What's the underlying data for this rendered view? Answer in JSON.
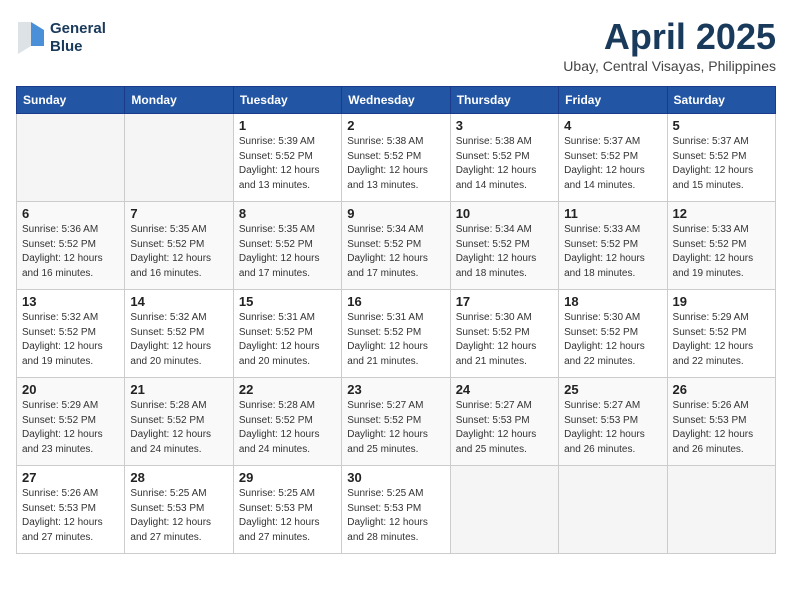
{
  "header": {
    "logo_line1": "General",
    "logo_line2": "Blue",
    "month_title": "April 2025",
    "location": "Ubay, Central Visayas, Philippines"
  },
  "weekdays": [
    "Sunday",
    "Monday",
    "Tuesday",
    "Wednesday",
    "Thursday",
    "Friday",
    "Saturday"
  ],
  "weeks": [
    [
      {
        "day": null,
        "sunrise": null,
        "sunset": null,
        "daylight": null
      },
      {
        "day": null,
        "sunrise": null,
        "sunset": null,
        "daylight": null
      },
      {
        "day": "1",
        "sunrise": "Sunrise: 5:39 AM",
        "sunset": "Sunset: 5:52 PM",
        "daylight": "Daylight: 12 hours and 13 minutes."
      },
      {
        "day": "2",
        "sunrise": "Sunrise: 5:38 AM",
        "sunset": "Sunset: 5:52 PM",
        "daylight": "Daylight: 12 hours and 13 minutes."
      },
      {
        "day": "3",
        "sunrise": "Sunrise: 5:38 AM",
        "sunset": "Sunset: 5:52 PM",
        "daylight": "Daylight: 12 hours and 14 minutes."
      },
      {
        "day": "4",
        "sunrise": "Sunrise: 5:37 AM",
        "sunset": "Sunset: 5:52 PM",
        "daylight": "Daylight: 12 hours and 14 minutes."
      },
      {
        "day": "5",
        "sunrise": "Sunrise: 5:37 AM",
        "sunset": "Sunset: 5:52 PM",
        "daylight": "Daylight: 12 hours and 15 minutes."
      }
    ],
    [
      {
        "day": "6",
        "sunrise": "Sunrise: 5:36 AM",
        "sunset": "Sunset: 5:52 PM",
        "daylight": "Daylight: 12 hours and 16 minutes."
      },
      {
        "day": "7",
        "sunrise": "Sunrise: 5:35 AM",
        "sunset": "Sunset: 5:52 PM",
        "daylight": "Daylight: 12 hours and 16 minutes."
      },
      {
        "day": "8",
        "sunrise": "Sunrise: 5:35 AM",
        "sunset": "Sunset: 5:52 PM",
        "daylight": "Daylight: 12 hours and 17 minutes."
      },
      {
        "day": "9",
        "sunrise": "Sunrise: 5:34 AM",
        "sunset": "Sunset: 5:52 PM",
        "daylight": "Daylight: 12 hours and 17 minutes."
      },
      {
        "day": "10",
        "sunrise": "Sunrise: 5:34 AM",
        "sunset": "Sunset: 5:52 PM",
        "daylight": "Daylight: 12 hours and 18 minutes."
      },
      {
        "day": "11",
        "sunrise": "Sunrise: 5:33 AM",
        "sunset": "Sunset: 5:52 PM",
        "daylight": "Daylight: 12 hours and 18 minutes."
      },
      {
        "day": "12",
        "sunrise": "Sunrise: 5:33 AM",
        "sunset": "Sunset: 5:52 PM",
        "daylight": "Daylight: 12 hours and 19 minutes."
      }
    ],
    [
      {
        "day": "13",
        "sunrise": "Sunrise: 5:32 AM",
        "sunset": "Sunset: 5:52 PM",
        "daylight": "Daylight: 12 hours and 19 minutes."
      },
      {
        "day": "14",
        "sunrise": "Sunrise: 5:32 AM",
        "sunset": "Sunset: 5:52 PM",
        "daylight": "Daylight: 12 hours and 20 minutes."
      },
      {
        "day": "15",
        "sunrise": "Sunrise: 5:31 AM",
        "sunset": "Sunset: 5:52 PM",
        "daylight": "Daylight: 12 hours and 20 minutes."
      },
      {
        "day": "16",
        "sunrise": "Sunrise: 5:31 AM",
        "sunset": "Sunset: 5:52 PM",
        "daylight": "Daylight: 12 hours and 21 minutes."
      },
      {
        "day": "17",
        "sunrise": "Sunrise: 5:30 AM",
        "sunset": "Sunset: 5:52 PM",
        "daylight": "Daylight: 12 hours and 21 minutes."
      },
      {
        "day": "18",
        "sunrise": "Sunrise: 5:30 AM",
        "sunset": "Sunset: 5:52 PM",
        "daylight": "Daylight: 12 hours and 22 minutes."
      },
      {
        "day": "19",
        "sunrise": "Sunrise: 5:29 AM",
        "sunset": "Sunset: 5:52 PM",
        "daylight": "Daylight: 12 hours and 22 minutes."
      }
    ],
    [
      {
        "day": "20",
        "sunrise": "Sunrise: 5:29 AM",
        "sunset": "Sunset: 5:52 PM",
        "daylight": "Daylight: 12 hours and 23 minutes."
      },
      {
        "day": "21",
        "sunrise": "Sunrise: 5:28 AM",
        "sunset": "Sunset: 5:52 PM",
        "daylight": "Daylight: 12 hours and 24 minutes."
      },
      {
        "day": "22",
        "sunrise": "Sunrise: 5:28 AM",
        "sunset": "Sunset: 5:52 PM",
        "daylight": "Daylight: 12 hours and 24 minutes."
      },
      {
        "day": "23",
        "sunrise": "Sunrise: 5:27 AM",
        "sunset": "Sunset: 5:52 PM",
        "daylight": "Daylight: 12 hours and 25 minutes."
      },
      {
        "day": "24",
        "sunrise": "Sunrise: 5:27 AM",
        "sunset": "Sunset: 5:53 PM",
        "daylight": "Daylight: 12 hours and 25 minutes."
      },
      {
        "day": "25",
        "sunrise": "Sunrise: 5:27 AM",
        "sunset": "Sunset: 5:53 PM",
        "daylight": "Daylight: 12 hours and 26 minutes."
      },
      {
        "day": "26",
        "sunrise": "Sunrise: 5:26 AM",
        "sunset": "Sunset: 5:53 PM",
        "daylight": "Daylight: 12 hours and 26 minutes."
      }
    ],
    [
      {
        "day": "27",
        "sunrise": "Sunrise: 5:26 AM",
        "sunset": "Sunset: 5:53 PM",
        "daylight": "Daylight: 12 hours and 27 minutes."
      },
      {
        "day": "28",
        "sunrise": "Sunrise: 5:25 AM",
        "sunset": "Sunset: 5:53 PM",
        "daylight": "Daylight: 12 hours and 27 minutes."
      },
      {
        "day": "29",
        "sunrise": "Sunrise: 5:25 AM",
        "sunset": "Sunset: 5:53 PM",
        "daylight": "Daylight: 12 hours and 27 minutes."
      },
      {
        "day": "30",
        "sunrise": "Sunrise: 5:25 AM",
        "sunset": "Sunset: 5:53 PM",
        "daylight": "Daylight: 12 hours and 28 minutes."
      },
      {
        "day": null,
        "sunrise": null,
        "sunset": null,
        "daylight": null
      },
      {
        "day": null,
        "sunrise": null,
        "sunset": null,
        "daylight": null
      },
      {
        "day": null,
        "sunrise": null,
        "sunset": null,
        "daylight": null
      }
    ]
  ]
}
